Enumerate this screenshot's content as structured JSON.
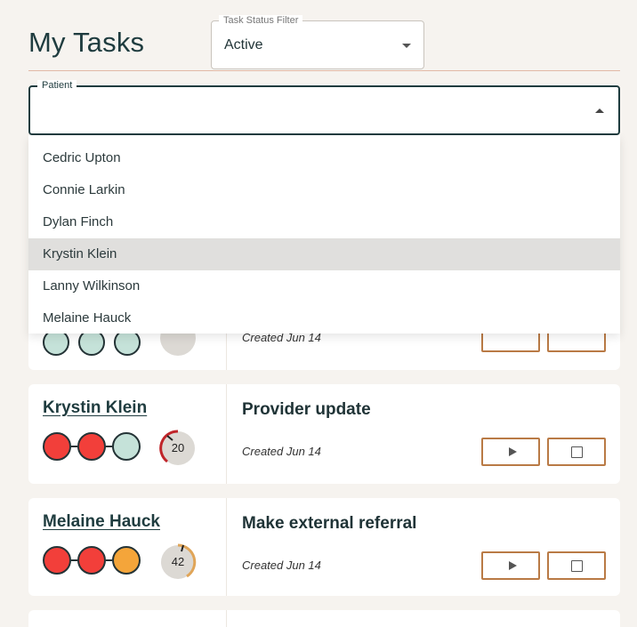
{
  "header": {
    "title": "My Tasks",
    "status_filter": {
      "label": "Task Status Filter",
      "value": "Active"
    }
  },
  "patient_filter": {
    "label": "Patient",
    "value": "",
    "options": [
      "Cedric Upton",
      "Connie Larkin",
      "Dylan Finch",
      "Krystin Klein",
      "Lanny Wilkinson",
      "Melaine Hauck"
    ],
    "highlighted": "Krystin Klein"
  },
  "partial_card": {
    "created": "Created Jun 14"
  },
  "tasks": [
    {
      "patient": "Krystin Klein",
      "title": "Provider update",
      "created": "Created Jun 14",
      "status_dots": [
        "red",
        "red",
        "green"
      ],
      "score": "20",
      "gauge_color": "#c0252a"
    },
    {
      "patient": "Melaine Hauck",
      "title": "Make external referral",
      "created": "Created Jun 14",
      "status_dots": [
        "red",
        "red",
        "orange"
      ],
      "score": "42",
      "gauge_color": "#e0a558"
    }
  ],
  "colors": {
    "red": "#f23f3a",
    "green": "#c5e2d9",
    "orange": "#f4a53a",
    "accent": "#b97a45",
    "dark": "#1f3c3f"
  },
  "icons": {
    "play": "play-icon",
    "stop": "square-icon",
    "dropdown": "caret-down-icon"
  }
}
